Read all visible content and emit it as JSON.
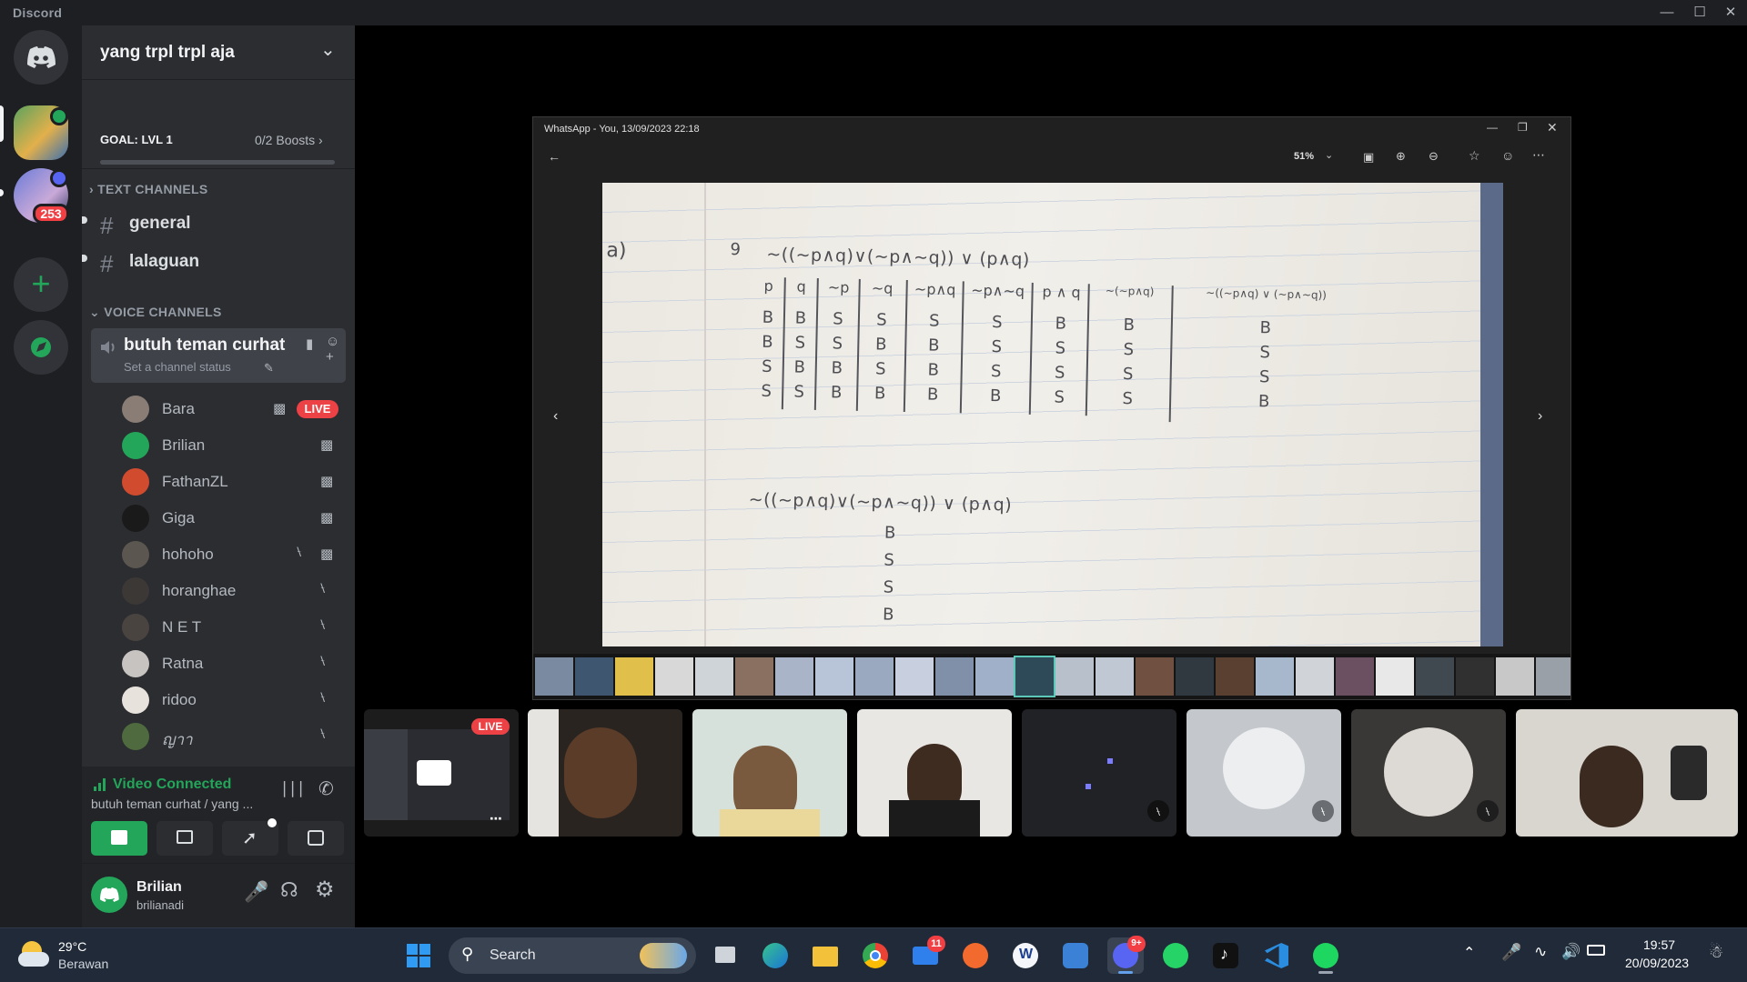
{
  "app": {
    "title": "Discord"
  },
  "guilds": {
    "mention_badge": "253"
  },
  "server": {
    "name": "yang trpl trpl aja",
    "goal_label": "GOAL: LVL 1",
    "boosts": "0/2 Boosts"
  },
  "text_channels": {
    "header": "TEXT CHANNELS",
    "items": [
      {
        "label": "general"
      },
      {
        "label": "lalaguan"
      }
    ]
  },
  "voice_channels": {
    "header": "VOICE CHANNELS",
    "channel": {
      "name": "butuh teman curhat",
      "status_placeholder": "Set a channel status"
    },
    "users": [
      {
        "name": "Bara",
        "badge": "LIVE"
      },
      {
        "name": "Brilian"
      },
      {
        "name": "FathanZL"
      },
      {
        "name": "Giga"
      },
      {
        "name": "hohoho"
      },
      {
        "name": "horanghae"
      },
      {
        "name": "N E T"
      },
      {
        "name": "Ratna"
      },
      {
        "name": "ridoo"
      },
      {
        "name": "ญาา"
      }
    ]
  },
  "voice_panel": {
    "status": "Video Connected",
    "channel": "butuh teman curhat / yang ..."
  },
  "user_panel": {
    "display_name": "Brilian",
    "username": "brilianadi"
  },
  "viewer": {
    "title": "WhatsApp - You, 13/09/2023 22:18",
    "zoom": "51%",
    "notebook": {
      "problem": "a)",
      "number": "9",
      "formula": "~((~p∧q)∨(~p∧~q)) ∨ (p∧q)",
      "headers": [
        "p",
        "q",
        "~p",
        "~q",
        "~p∧q",
        "~p∧~q",
        "p ∧ q",
        "~(~p∧q)",
        "~((~p∧q) ∨ (~p∧~q))"
      ],
      "rows": [
        [
          "B",
          "B",
          "S",
          "S",
          "S",
          "S",
          "B",
          "B",
          "B"
        ],
        [
          "B",
          "S",
          "S",
          "B",
          "B",
          "S",
          "S",
          "S",
          "S"
        ],
        [
          "S",
          "B",
          "B",
          "S",
          "B",
          "S",
          "S",
          "S",
          "S"
        ],
        [
          "S",
          "S",
          "B",
          "B",
          "B",
          "B",
          "S",
          "S",
          "B"
        ]
      ],
      "formula2": "~((~p∧q)∨(~p∧~q)) ∨ (p∧q)",
      "result": [
        "B",
        "S",
        "S",
        "B"
      ]
    }
  },
  "stream_tile": {
    "badge": "LIVE"
  },
  "taskbar": {
    "weather_temp": "29°C",
    "weather_desc": "Berawan",
    "search_label": "Search",
    "mail_badge": "11",
    "discord_badge": "9+",
    "time": "19:57",
    "date": "20/09/2023"
  },
  "colors": {
    "discord_green": "#23a55a",
    "live_red": "#ed4245",
    "blurple": "#5865f2"
  }
}
